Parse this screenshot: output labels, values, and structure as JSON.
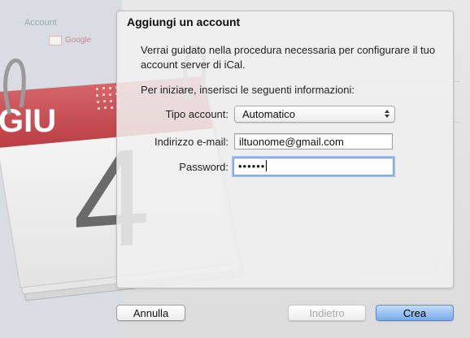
{
  "dialog": {
    "title": "Aggiungi un account",
    "description": "Verrai guidato nella procedura necessaria per configurare il tuo account server di iCal.",
    "intro": "Per iniziare, inserisci le seguenti informazioni:"
  },
  "form": {
    "account_type_label": "Tipo account:",
    "account_type_value": "Automatico",
    "email_label": "Indirizzo e-mail:",
    "email_value": "iltuonome@gmail.com",
    "password_label": "Password:",
    "password_value": "••••••"
  },
  "buttons": {
    "cancel": "Annulla",
    "back": "Indietro",
    "create": "Crea"
  },
  "calendar_icon": {
    "month": "GIU",
    "day": "4"
  },
  "background": {
    "sidebar_label": "Account",
    "account_name": "Google"
  },
  "colors": {
    "calendar_red": "#c9494f",
    "focus_blue": "#6f9fde",
    "default_button_blue": "#75aaf0"
  }
}
